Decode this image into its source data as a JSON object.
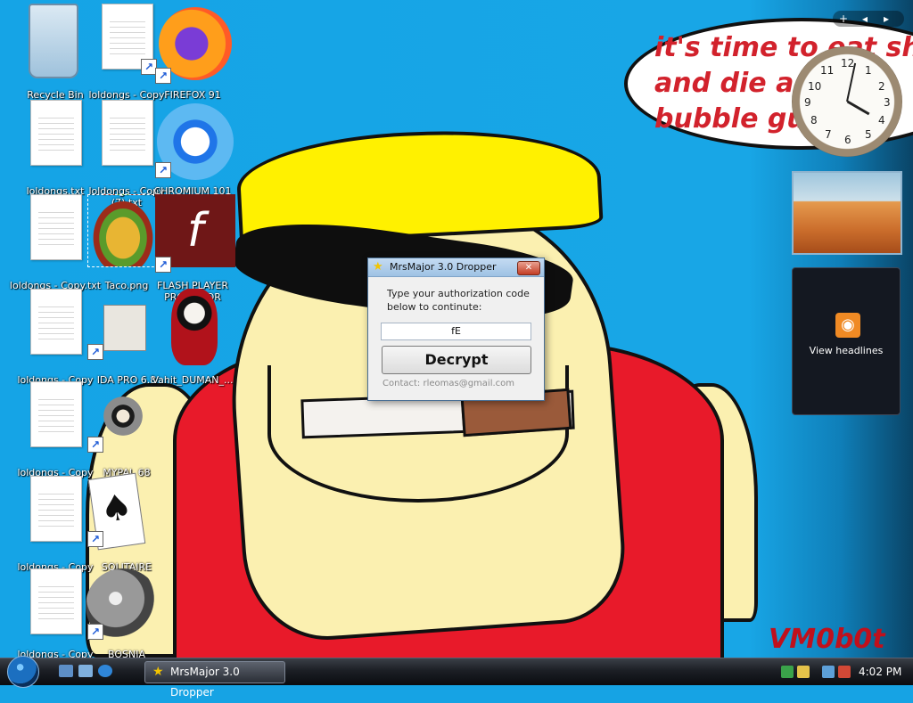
{
  "desktop": {
    "wallpaper_text": [
      "it's time to eat shi",
      "and die and",
      "bubble gu"
    ],
    "watermark": "VM0b0t",
    "icons": [
      {
        "label": "Recycle Bin",
        "type": "bin"
      },
      {
        "label": "loldongs - Copy",
        "type": "doc"
      },
      {
        "label": "FIREFOX 91",
        "type": "firefox"
      },
      {
        "label": "loldongs.txt",
        "type": "doc"
      },
      {
        "label": "loldongs - Copy (7).txt",
        "type": "doc"
      },
      {
        "label": "CHROMIUM 101",
        "type": "chromium"
      },
      {
        "label": "loldongs - Copy.txt",
        "type": "doc"
      },
      {
        "label": "Taco.png",
        "type": "taco"
      },
      {
        "label": "FLASH PLAYER PROJECTOR",
        "type": "flash"
      },
      {
        "label": "loldongs - Copy",
        "type": "doc"
      },
      {
        "label": "IDA PRO 6.8",
        "type": "ida"
      },
      {
        "label": "Vahit_DUMAN_...",
        "type": "doll"
      },
      {
        "label": "loldongs - Copy",
        "type": "doc"
      },
      {
        "label": "MYPAL 68",
        "type": "mypal"
      },
      {
        "label": "loldongs - Copy",
        "type": "doc"
      },
      {
        "label": "SOLITAIRE",
        "type": "solitaire"
      },
      {
        "label": "loldongs - Copy",
        "type": "doc"
      },
      {
        "label": "BOSNIA",
        "type": "mine"
      }
    ]
  },
  "gadgets": {
    "toolbar": {
      "add": "+",
      "prev": "◂",
      "next": "▸"
    },
    "clock": {
      "numbers": [
        "12",
        "1",
        "2",
        "3",
        "4",
        "5",
        "6",
        "7",
        "8",
        "9",
        "10",
        "11"
      ]
    },
    "feeds": {
      "label": "View headlines"
    }
  },
  "dialog": {
    "title": "MrsMajor 3.0 Dropper",
    "close": "✕",
    "prompt": "Type your authorization code below to continute:",
    "code_value": "fE",
    "decrypt_label": "Decrypt",
    "contact": "Contact: rleomas@gmail.com"
  },
  "taskbar": {
    "task_label": "MrsMajor 3.0 Dropper",
    "time": "4:02 PM"
  },
  "colors": {
    "desktop": "#16a3e4",
    "bubble_text": "#d2222c",
    "shirt": "#e81a2a",
    "hat": "#fff100"
  }
}
